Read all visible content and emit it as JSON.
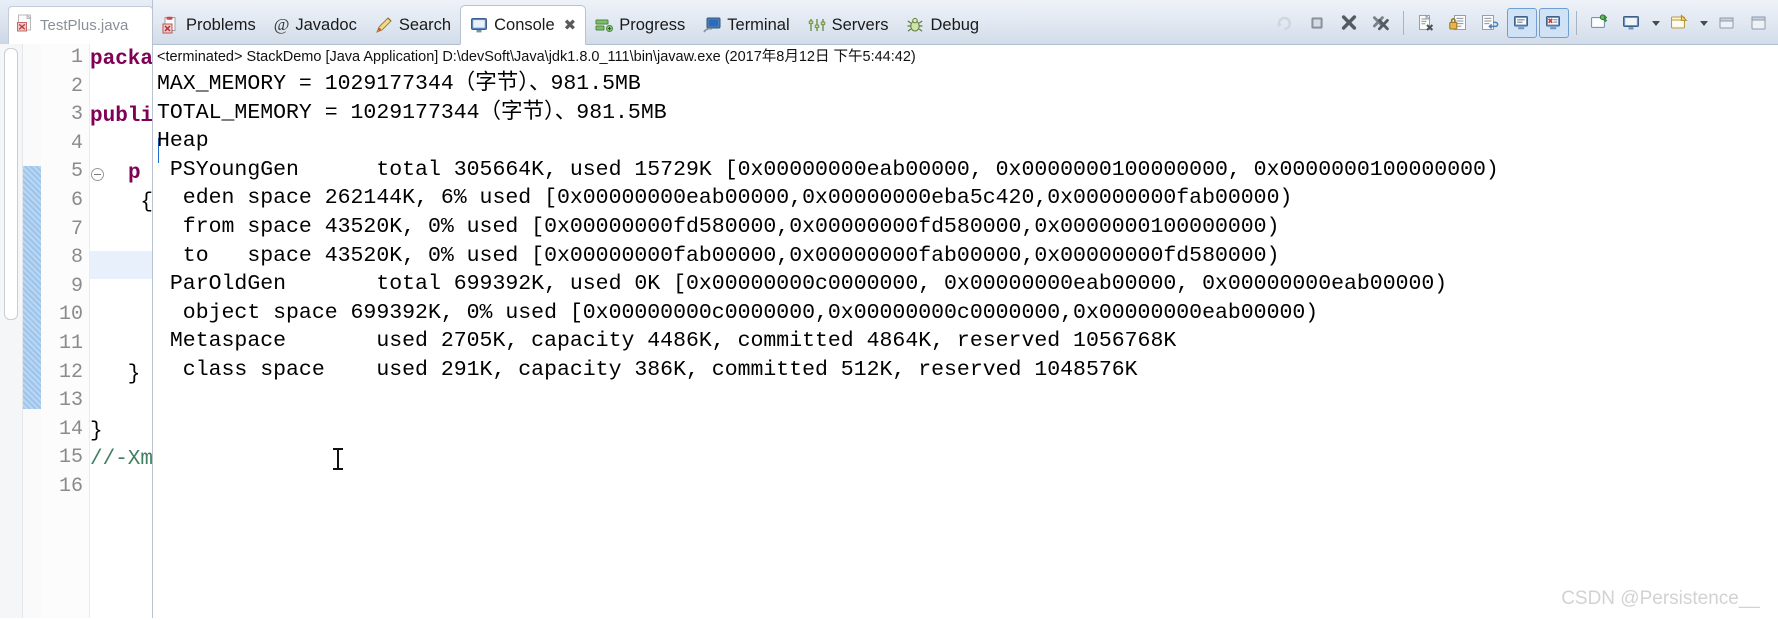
{
  "editor": {
    "tab": {
      "label": "TestPlus.java",
      "icon": "java-file-icon"
    },
    "line_numbers": [
      "1",
      "2",
      "3",
      "4",
      "5",
      "6",
      "7",
      "8",
      "9",
      "10",
      "11",
      "12",
      "13",
      "14",
      "15",
      "16"
    ],
    "code_lines": [
      {
        "n": 1,
        "kw": "packa",
        "plain": ""
      },
      {
        "n": 2,
        "kw": "",
        "plain": ""
      },
      {
        "n": 3,
        "kw": "publi",
        "plain": ""
      },
      {
        "n": 4,
        "kw": "",
        "plain": ""
      },
      {
        "n": 5,
        "kw": "p",
        "plain": ""
      },
      {
        "n": 6,
        "kw": "",
        "plain": "{"
      },
      {
        "n": 7,
        "kw": "",
        "plain": ""
      },
      {
        "n": 8,
        "kw": "",
        "plain": ""
      },
      {
        "n": 9,
        "kw": "",
        "plain": ""
      },
      {
        "n": 10,
        "kw": "",
        "plain": ""
      },
      {
        "n": 11,
        "kw": "",
        "plain": ""
      },
      {
        "n": 12,
        "kw": "",
        "plain": "}"
      },
      {
        "n": 13,
        "kw": "",
        "plain": ""
      },
      {
        "n": 14,
        "kw": "",
        "plain": "}"
      },
      {
        "n": 15,
        "kw": "",
        "plain": "",
        "comment": "//-Xm"
      },
      {
        "n": 16,
        "kw": "",
        "plain": ""
      }
    ]
  },
  "view_tabs": [
    {
      "label": "Problems",
      "icon": "problems-icon",
      "active": false
    },
    {
      "label": "Javadoc",
      "icon": "javadoc-at-icon",
      "active": false
    },
    {
      "label": "Search",
      "icon": "search-pencil-icon",
      "active": false
    },
    {
      "label": "Console",
      "icon": "console-icon",
      "active": true,
      "close": "✖"
    },
    {
      "label": "Progress",
      "icon": "progress-icon",
      "active": false
    },
    {
      "label": "Terminal",
      "icon": "terminal-icon",
      "active": false
    },
    {
      "label": "Servers",
      "icon": "servers-icon",
      "active": false
    },
    {
      "label": "Debug",
      "icon": "debug-bug-icon",
      "active": false
    }
  ],
  "toolbar": [
    {
      "name": "rerun-icon",
      "toggled": false
    },
    {
      "name": "terminate-icon",
      "toggled": false
    },
    {
      "name": "remove-launch-icon",
      "toggled": false
    },
    {
      "name": "remove-all-terminated-icon",
      "toggled": false
    },
    {
      "name": "separator",
      "toggled": false
    },
    {
      "name": "clear-console-icon",
      "toggled": false
    },
    {
      "name": "scroll-lock-icon",
      "toggled": false
    },
    {
      "name": "word-wrap-icon",
      "toggled": false
    },
    {
      "name": "show-console-on-output-icon",
      "toggled": true
    },
    {
      "name": "show-console-on-error-icon",
      "toggled": true
    },
    {
      "name": "separator",
      "toggled": false
    },
    {
      "name": "pin-console-icon",
      "toggled": false
    },
    {
      "name": "display-selected-console-icon",
      "toggled": false
    },
    {
      "name": "display-console-dropdown-icon",
      "toggled": false
    },
    {
      "name": "open-console-icon",
      "toggled": false
    },
    {
      "name": "open-console-dropdown-icon",
      "toggled": false
    },
    {
      "name": "minimize-icon",
      "toggled": false
    },
    {
      "name": "maximize-icon",
      "toggled": false
    }
  ],
  "console": {
    "header": "<terminated> StackDemo [Java Application] D:\\devSoft\\Java\\jdk1.8.0_111\\bin\\javaw.exe (2017年8月12日 下午5:44:42)",
    "lines": [
      "MAX_MEMORY = 1029177344（字节）、981.5MB",
      "TOTAL_MEMORY = 1029177344（字节）、981.5MB",
      "Heap",
      " PSYoungGen      total 305664K, used 15729K [0x00000000eab00000, 0x0000000100000000, 0x0000000100000000)",
      "  eden space 262144K, 6% used [0x00000000eab00000,0x00000000eba5c420,0x00000000fab00000)",
      "  from space 43520K, 0% used [0x00000000fd580000,0x00000000fd580000,0x0000000100000000)",
      "  to   space 43520K, 0% used [0x00000000fab00000,0x00000000fab00000,0x00000000fd580000)",
      " ParOldGen       total 699392K, used 0K [0x00000000c0000000, 0x00000000eab00000, 0x00000000eab00000)",
      "  object space 699392K, 0% used [0x00000000c0000000,0x00000000c0000000,0x00000000eab00000)",
      " Metaspace       used 2705K, capacity 4486K, committed 4864K, reserved 1056768K",
      "  class space    used 291K, capacity 386K, committed 512K, reserved 1048576K"
    ]
  },
  "watermark": "CSDN @Persistence__"
}
